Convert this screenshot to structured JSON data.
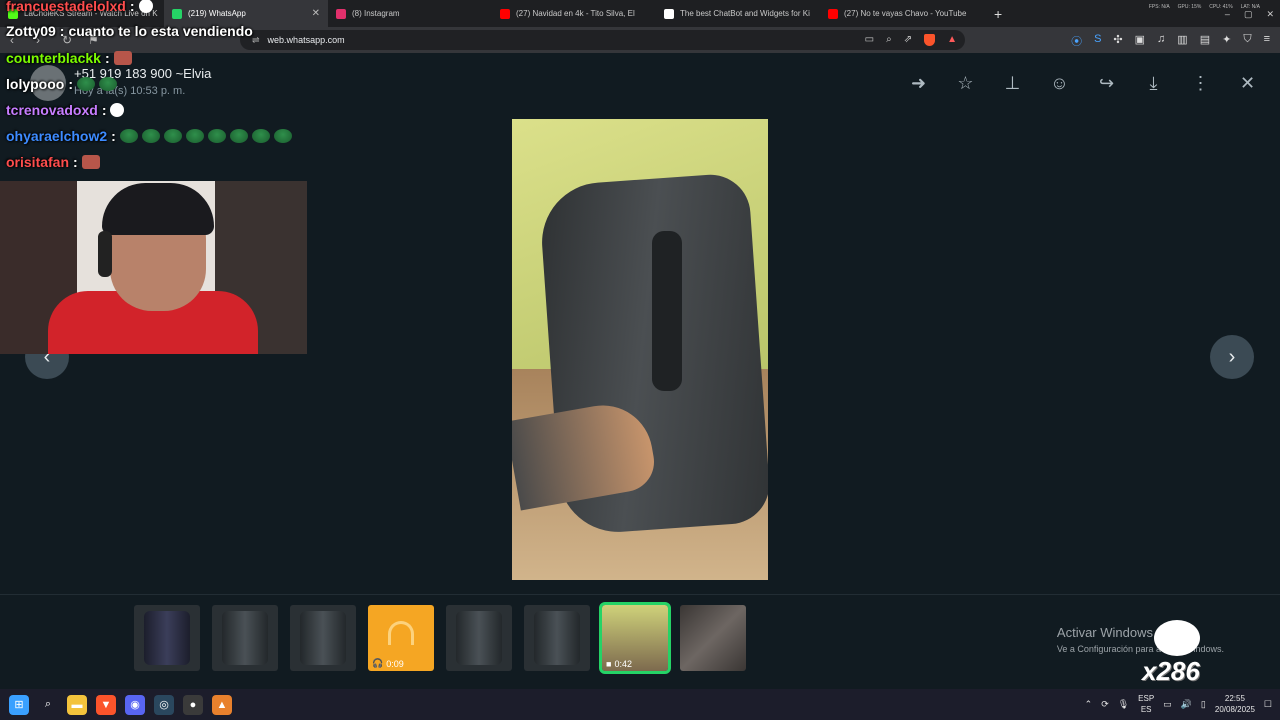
{
  "browser": {
    "tabs": [
      {
        "title": "LaCholeKS Stream - Watch Live on K",
        "favicon_color": "#53fc18"
      },
      {
        "title": "(219) WhatsApp",
        "favicon_color": "#25d366",
        "active": true
      },
      {
        "title": "(8) Instagram",
        "favicon_color": "#e1306c"
      },
      {
        "title": "(27) Navidad en 4k - Tito Silva, El",
        "favicon_color": "#ff0000"
      },
      {
        "title": "The best ChatBot and Widgets for Ki",
        "favicon_color": "#ffffff"
      },
      {
        "title": "(27) No te vayas Chavo - YouTube",
        "favicon_color": "#ff0000"
      }
    ],
    "new_tab_label": "+",
    "sysinfo": [
      "FPS: N/A",
      "GPU: 15%",
      "CPU: 41%",
      "LAT: N/A"
    ],
    "url": "web.whatsapp.com"
  },
  "viewer": {
    "sender_name": "+51 919 183 900 ~Elvia",
    "sender_time": "Hoy a la(s) 10:53 p. m.",
    "toolbar_icons": [
      "arrow-right-icon",
      "star-icon",
      "pin-icon",
      "emoji-icon",
      "forward-icon",
      "download-icon",
      "more-icon",
      "close-icon"
    ],
    "thumbnails": [
      {
        "kind": "image",
        "style": "bag-dark"
      },
      {
        "kind": "image",
        "style": "bag"
      },
      {
        "kind": "image",
        "style": "bag"
      },
      {
        "kind": "audio",
        "duration": "0:09"
      },
      {
        "kind": "image",
        "style": "bag"
      },
      {
        "kind": "image",
        "style": "bag"
      },
      {
        "kind": "video",
        "duration": "0:42",
        "selected": true
      },
      {
        "kind": "image",
        "style": "fabric"
      }
    ]
  },
  "watermark": {
    "line1": "Activar Windows",
    "line2": "Ve a Configuración para activar Windows."
  },
  "overlay": {
    "chat": [
      {
        "user": "francuestadelolxd",
        "color": "#ff4d4d",
        "msg": "",
        "emotes": [
          "skull"
        ]
      },
      {
        "user": "Zotty09",
        "color": "#ffffff",
        "msg": "cuanto te lo esta vendiendo",
        "emotes": []
      },
      {
        "user": "counterblackk",
        "color": "#7cfc00",
        "msg": "",
        "emotes": [
          "face"
        ]
      },
      {
        "user": "lolypooo",
        "color": "#ffffff",
        "msg": "",
        "emotes": [
          "pepe",
          "pepe"
        ]
      },
      {
        "user": "tcrenovadoxd",
        "color": "#c77dff",
        "msg": "",
        "emotes": [
          "skull"
        ]
      },
      {
        "user": "ohyaraelchow2",
        "color": "#3d8bff",
        "msg": "",
        "emotes": [
          "pepe",
          "pepe",
          "pepe",
          "pepe",
          "pepe",
          "pepe",
          "pepe",
          "pepe"
        ]
      },
      {
        "user": "orisitafan",
        "color": "#ff4d4d",
        "msg": "",
        "emotes": [
          "face"
        ]
      }
    ],
    "badge_text": "x286"
  },
  "taskbar": {
    "lang_top": "ESP",
    "lang_bottom": "ES",
    "time": "22:55",
    "date": "20/08/2025",
    "apps": [
      {
        "name": "windows-start-icon",
        "color": "#3aa0ff",
        "glyph": "⊞"
      },
      {
        "name": "search-icon",
        "color": "transparent",
        "glyph": "⌕"
      },
      {
        "name": "file-explorer-icon",
        "color": "#f3c33c",
        "glyph": "▬"
      },
      {
        "name": "brave-browser-icon",
        "color": "#fb542b",
        "glyph": "▼"
      },
      {
        "name": "discord-icon",
        "color": "#5865f2",
        "glyph": "◉"
      },
      {
        "name": "steam-icon",
        "color": "#2a475e",
        "glyph": "◎"
      },
      {
        "name": "obs-icon",
        "color": "#3a3a3a",
        "glyph": "●"
      },
      {
        "name": "app-icon",
        "color": "#e8812d",
        "glyph": "▲"
      }
    ]
  }
}
